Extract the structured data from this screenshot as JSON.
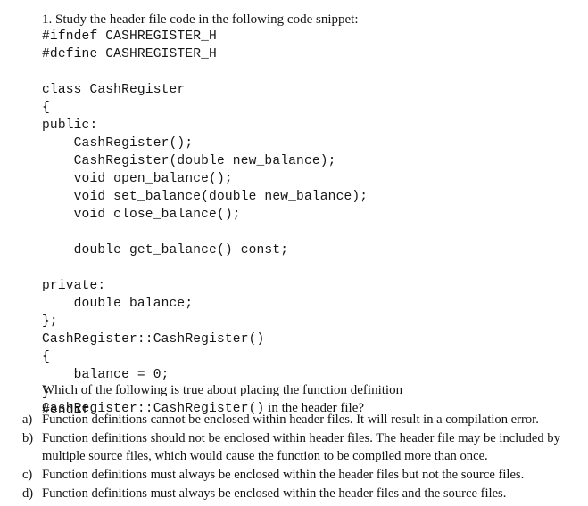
{
  "document": {
    "background_color": "#ffffff",
    "text_color": "#131313"
  },
  "question": {
    "number": "1.",
    "stem": "1. Study the header file code in the following code snippet:",
    "prompt_line_1": "Which of the following is true about placing the function definition",
    "prompt_code": "CashRegister::CashRegister()",
    "prompt_tail": " in the header file?"
  },
  "code_snippet": {
    "language": "cpp",
    "lines": [
      "#ifndef CASHREGISTER_H",
      "#define CASHREGISTER_H",
      "",
      "class CashRegister",
      "{",
      "public:",
      "    CashRegister();",
      "    CashRegister(double new_balance);",
      "    void open_balance();",
      "    void set_balance(double new_balance);",
      "    void close_balance();",
      "",
      "    double get_balance() const;",
      "",
      "private:",
      "    double balance;",
      "};",
      "CashRegister::CashRegister()",
      "{",
      "    balance = 0;",
      "}",
      "#endif"
    ]
  },
  "options": [
    {
      "marker": "a)",
      "text": "Function definitions cannot be enclosed within header files. It will result in a compilation error."
    },
    {
      "marker": "b)",
      "text": "Function definitions should not be enclosed within header files. The header file may be included by multiple source files, which would cause the function to be compiled more than once."
    },
    {
      "marker": "c)",
      "text": "Function definitions must always be enclosed within the header files but not the source files."
    },
    {
      "marker": "d)",
      "text": "Function definitions must always be enclosed within the header files and the source files."
    }
  ]
}
